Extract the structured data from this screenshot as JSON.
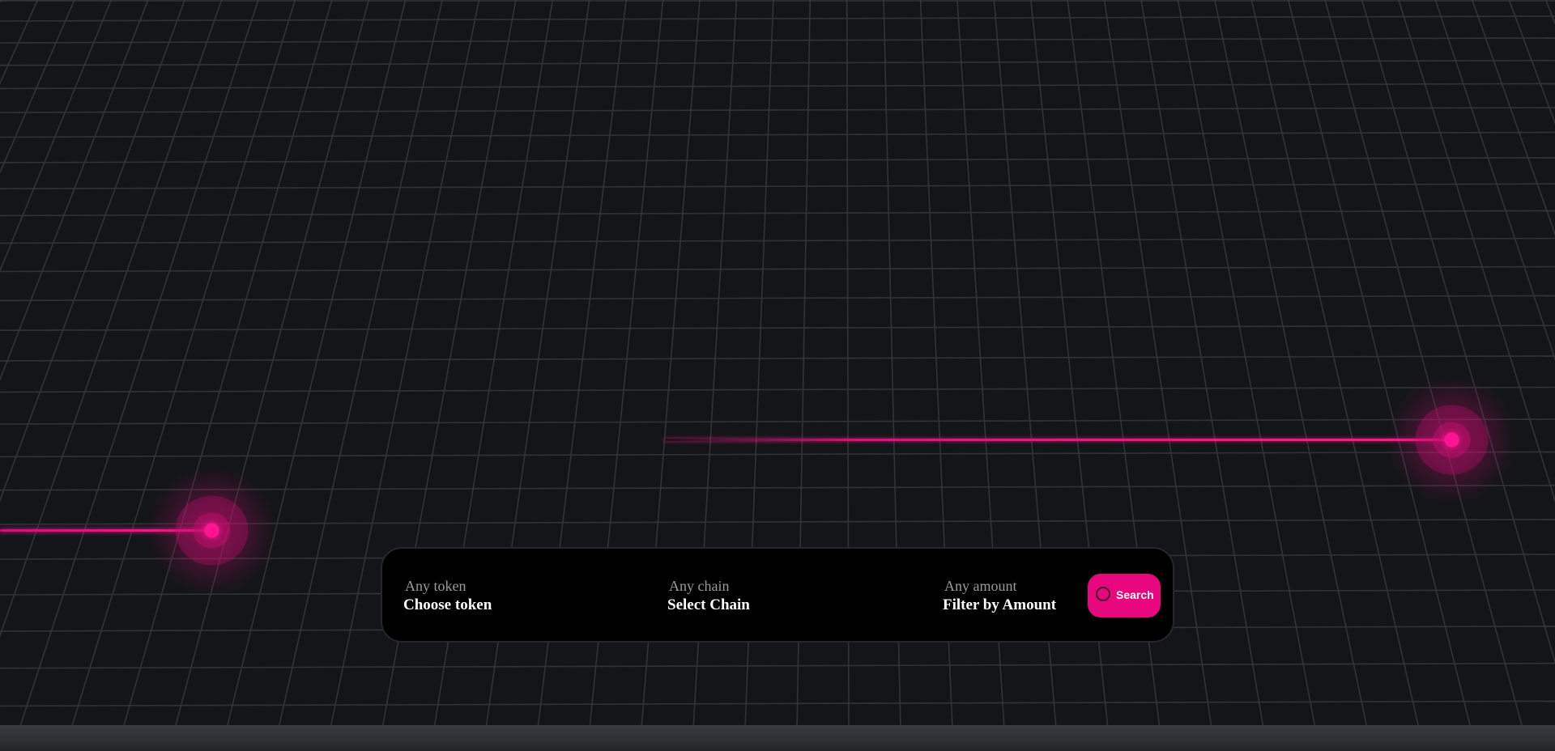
{
  "search": {
    "token": {
      "hint": "Any token",
      "value": "Choose token"
    },
    "chain": {
      "hint": "Any chain",
      "value": "Select Chain"
    },
    "amount": {
      "hint": "Any amount",
      "value": "Filter by Amount"
    },
    "button_label": "Search"
  },
  "icons": {
    "search_button_icon": "search-icon"
  },
  "colors": {
    "background": "#141519",
    "accent": "#e8077f",
    "grid_line": "#3a3b40",
    "panel": "#000000"
  }
}
